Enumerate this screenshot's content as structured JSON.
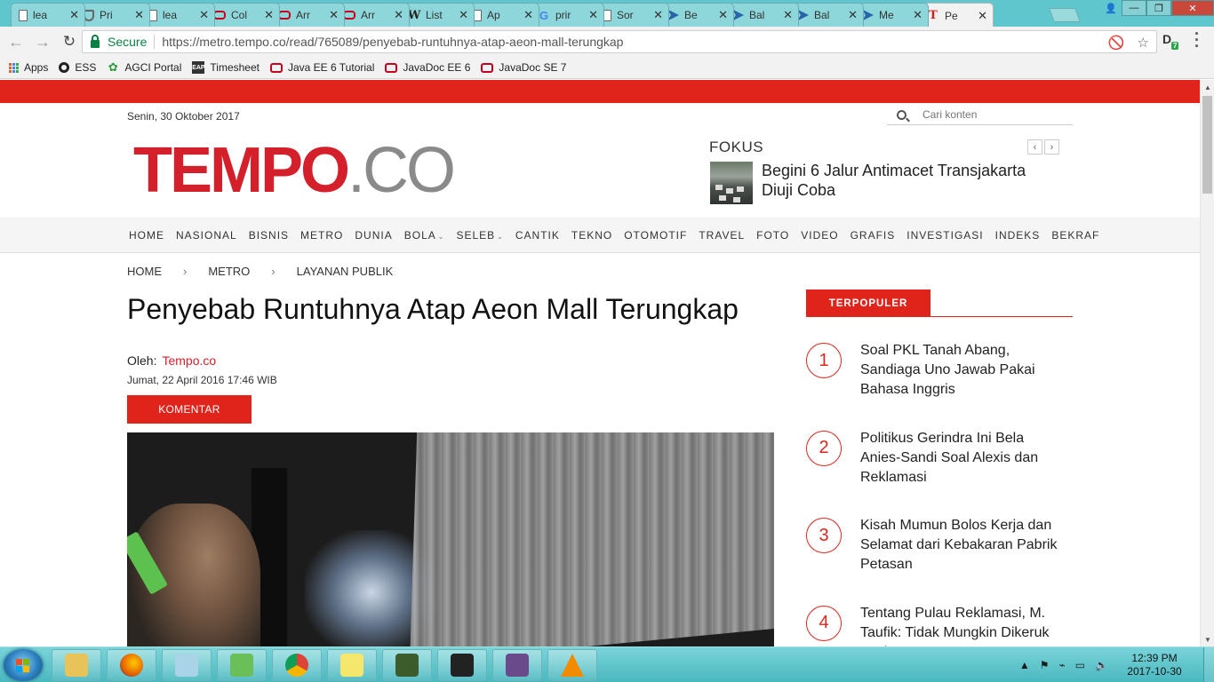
{
  "browser": {
    "tabs": [
      {
        "label": "lea",
        "favicon": "doc-icon"
      },
      {
        "label": "Pri",
        "favicon": "shield-icon"
      },
      {
        "label": "lea",
        "favicon": "doc-icon"
      },
      {
        "label": "Col",
        "favicon": "oracle-icon"
      },
      {
        "label": "Arr",
        "favicon": "oracle-icon"
      },
      {
        "label": "Arr",
        "favicon": "oracle-icon"
      },
      {
        "label": "List",
        "favicon": "wikipedia-icon"
      },
      {
        "label": "Ap",
        "favicon": "doc-icon"
      },
      {
        "label": "prir",
        "favicon": "google-icon"
      },
      {
        "label": "Sor",
        "favicon": "doc-icon"
      },
      {
        "label": "Be",
        "favicon": "blue-arrow-icon"
      },
      {
        "label": "Bal",
        "favicon": "blue-arrow-icon"
      },
      {
        "label": "Bal",
        "favicon": "blue-arrow-icon"
      },
      {
        "label": "Me",
        "favicon": "blue-arrow-icon"
      },
      {
        "label": "Pe",
        "favicon": "tempo-icon",
        "active": true
      }
    ],
    "tab_close_glyph": "✕",
    "window_buttons": {
      "minimize": "—",
      "maximize": "❐",
      "close": "✕"
    },
    "secure_label": "Secure",
    "url": "https://metro.tempo.co/read/765089/penyebab-runtuhnya-atap-aeon-mall-terungkap",
    "extension_badge": "7",
    "bookmarks": [
      {
        "label": "Apps",
        "icon": "apps-grid-icon"
      },
      {
        "label": "ESS",
        "icon": "ess-icon"
      },
      {
        "label": "AGCI Portal",
        "icon": "agci-icon"
      },
      {
        "label": "Timesheet",
        "icon": "eap-icon"
      },
      {
        "label": "Java EE 6 Tutorial",
        "icon": "oracle-icon"
      },
      {
        "label": "JavaDoc EE 6",
        "icon": "oracle-icon"
      },
      {
        "label": "JavaDoc SE 7",
        "icon": "oracle-icon"
      }
    ]
  },
  "site": {
    "date": "Senin, 30 Oktober 2017",
    "search_placeholder": "Cari konten",
    "logo_main": "TEMPO",
    "logo_suffix": ".CO",
    "brand_red": "#e0241b",
    "fokus": {
      "title": "FOKUS",
      "headline": "Begini 6 Jalur Antimacet Transjakarta Diuji Coba",
      "prev": "‹",
      "next": "›"
    },
    "nav": [
      {
        "label": "HOME"
      },
      {
        "label": "NASIONAL"
      },
      {
        "label": "BISNIS"
      },
      {
        "label": "METRO"
      },
      {
        "label": "DUNIA"
      },
      {
        "label": "BOLA",
        "dropdown": true
      },
      {
        "label": "SELEB",
        "dropdown": true
      },
      {
        "label": "CANTIK"
      },
      {
        "label": "TEKNO"
      },
      {
        "label": "OTOMOTIF"
      },
      {
        "label": "TRAVEL"
      },
      {
        "label": "FOTO"
      },
      {
        "label": "VIDEO"
      },
      {
        "label": "GRAFIS"
      },
      {
        "label": "INVESTIGASI"
      },
      {
        "label": "INDEKS"
      },
      {
        "label": "BEKRAF"
      }
    ],
    "breadcrumb": [
      "HOME",
      "METRO",
      "LAYANAN PUBLIK"
    ],
    "breadcrumb_sep": "›"
  },
  "article": {
    "title": "Penyebab Runtuhnya Atap Aeon Mall Terungkap",
    "byline_label": "Oleh:",
    "author": "Tempo.co",
    "published": "Jumat, 22 April 2016 17:46 WIB",
    "komentar_label": "KOMENTAR"
  },
  "sidebar": {
    "terpopuler_label": "TERPOPULER",
    "items": [
      {
        "num": "1",
        "title": "Soal PKL Tanah Abang, Sandiaga Uno Jawab Pakai Bahasa Inggris"
      },
      {
        "num": "2",
        "title": "Politikus Gerindra Ini Bela Anies-Sandi Soal Alexis dan Reklamasi"
      },
      {
        "num": "3",
        "title": "Kisah Mumun Bolos Kerja dan Selamat dari Kebakaran Pabrik Petasan"
      },
      {
        "num": "4",
        "title": "Tentang Pulau Reklamasi, M. Taufik: Tidak Mungkin Dikeruk Lagi"
      }
    ]
  },
  "taskbar": {
    "apps": [
      {
        "name": "file-explorer-icon",
        "color": "#e7c35a"
      },
      {
        "name": "firefox-icon",
        "color": "#e66000"
      },
      {
        "name": "notepad-icon",
        "color": "#a9d3e6"
      },
      {
        "name": "editor-icon",
        "color": "#6bbf59"
      },
      {
        "name": "chrome-icon",
        "color": "#db4437"
      },
      {
        "name": "sticky-notes-icon",
        "color": "#f4e76b"
      },
      {
        "name": "monitor-icon",
        "color": "#3d5c2c"
      },
      {
        "name": "inkscape-icon",
        "color": "#222222"
      },
      {
        "name": "java-ee-ide-icon",
        "color": "#6a4a8a"
      },
      {
        "name": "vlc-icon",
        "color": "#f28b00"
      }
    ],
    "time": "12:39 PM",
    "date": "2017-10-30"
  }
}
